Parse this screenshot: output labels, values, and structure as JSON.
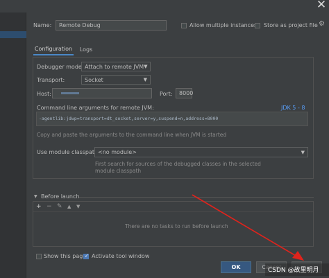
{
  "window": {
    "close_glyph": "✕"
  },
  "top": {
    "name_label": "Name:",
    "name_value": "Remote Debug",
    "allow_multiple_label": "Allow multiple instances",
    "store_as_project_label": "Store as project file",
    "gear_glyph": "⚙"
  },
  "tabs": [
    {
      "label": "Configuration",
      "selected": true
    },
    {
      "label": "Logs",
      "selected": false
    }
  ],
  "config": {
    "debugger_mode_label": "Debugger mode:",
    "debugger_mode_value": "Attach to remote JVM",
    "transport_label": "Transport:",
    "transport_value": "Socket",
    "host_label": "Host:",
    "host_value": "",
    "port_label": "Port:",
    "port_value": "8000",
    "cmd_args_label": "Command line arguments for remote JVM:",
    "jdk_selector": "JDK 5 - 8",
    "cmd_args_value": "-agentlib:jdwp=transport=dt_socket,server=y,suspend=n,address=8000",
    "cmd_args_hint": "Copy and paste the arguments to the command line when JVM is started",
    "module_classpath_label": "Use module classpath:",
    "module_classpath_value": "<no module>",
    "module_hint_line1": "First search for sources of the debugged classes in the selected",
    "module_hint_line2": "module classpath"
  },
  "before_launch": {
    "label": "Before launch",
    "empty_text": "There are no tasks to run before launch",
    "toolbar": {
      "add": "+",
      "remove": "−",
      "edit": "✎",
      "up": "▲",
      "down": "▼"
    }
  },
  "bottom": {
    "show_page_label": "Show this page",
    "activate_tool_label": "Activate tool window",
    "ok_label": "OK",
    "cancel_label": "Cancel"
  },
  "watermark": "CSDN @故里明月",
  "colors": {
    "background": "#3c3f41",
    "accent": "#4a88c7",
    "arrow": "#e0231c"
  }
}
